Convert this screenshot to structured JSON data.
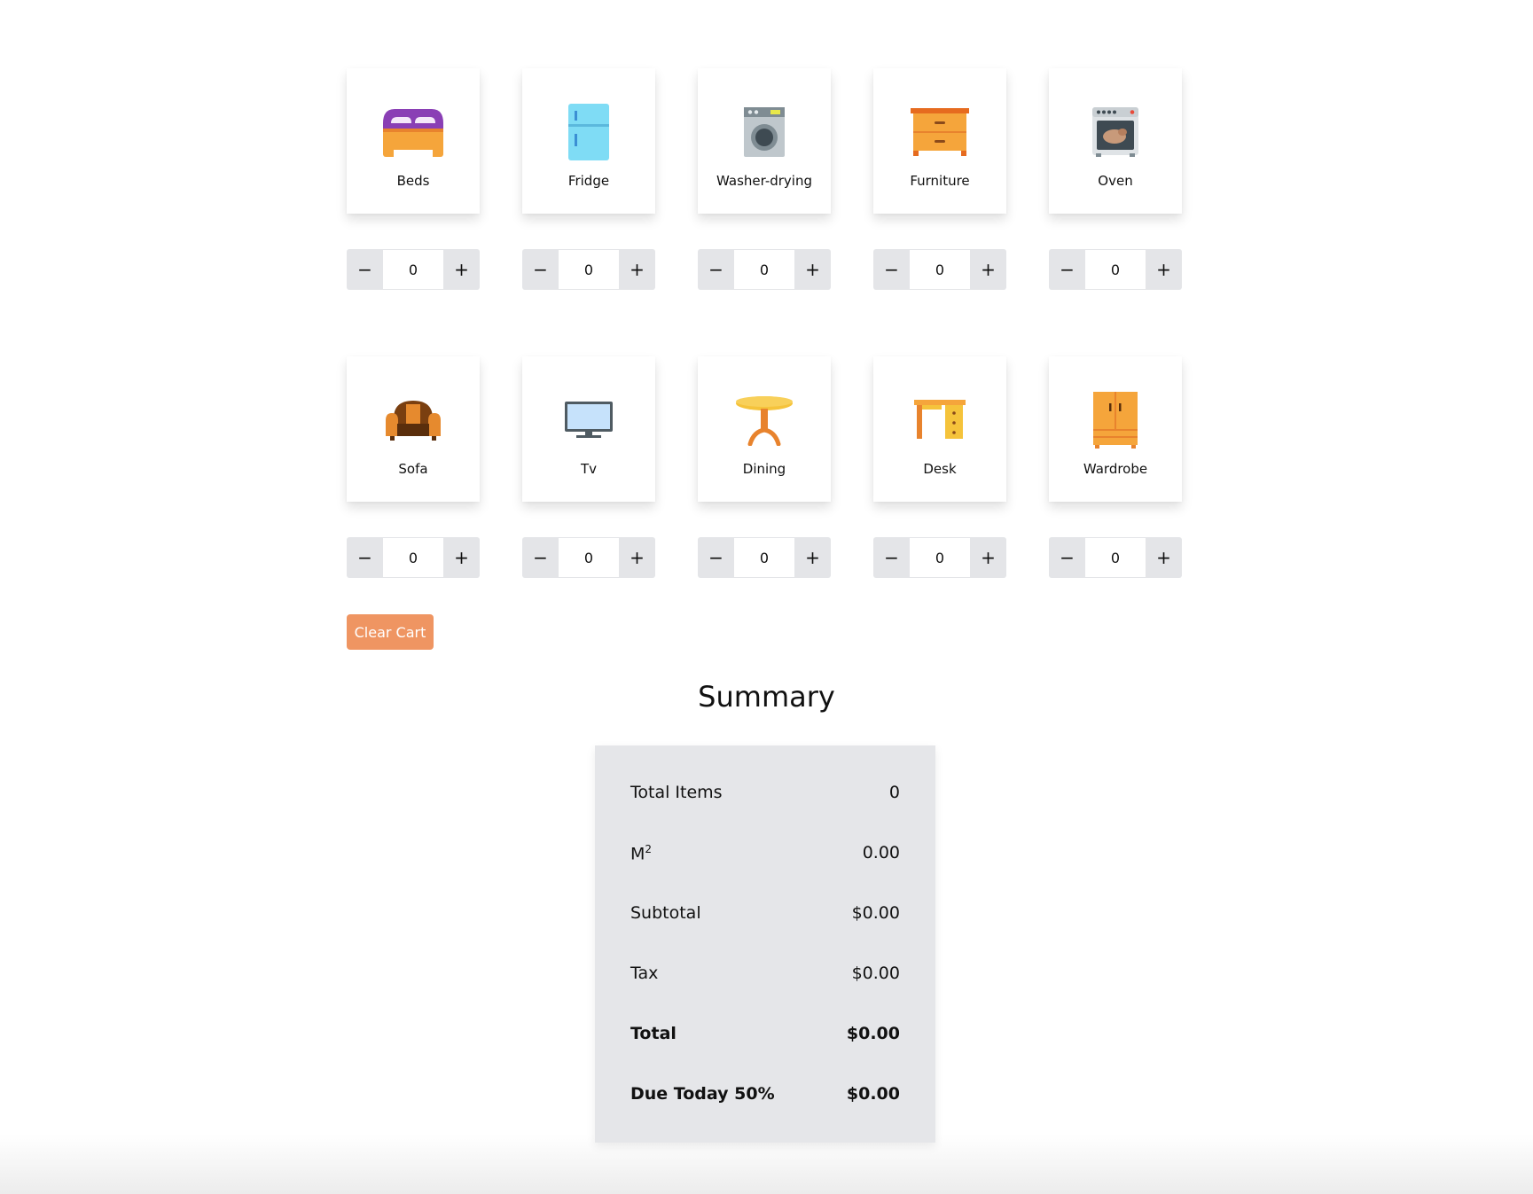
{
  "products": [
    {
      "name": "Beds",
      "icon": "bed-icon",
      "qty": "0"
    },
    {
      "name": "Fridge",
      "icon": "fridge-icon",
      "qty": "0"
    },
    {
      "name": "Washer-drying",
      "icon": "washing-machine-icon",
      "qty": "0"
    },
    {
      "name": "Furniture",
      "icon": "dresser-icon",
      "qty": "0"
    },
    {
      "name": "Oven",
      "icon": "oven-icon",
      "qty": "0"
    },
    {
      "name": "Sofa",
      "icon": "armchair-icon",
      "qty": "0"
    },
    {
      "name": "Tv",
      "icon": "tv-icon",
      "qty": "0"
    },
    {
      "name": "Dining",
      "icon": "dining-table-icon",
      "qty": "0"
    },
    {
      "name": "Desk",
      "icon": "desk-icon",
      "qty": "0"
    },
    {
      "name": "Wardrobe",
      "icon": "wardrobe-icon",
      "qty": "0"
    }
  ],
  "stepper": {
    "minus": "−",
    "plus": "+"
  },
  "clear_cart_label": "Clear Cart",
  "summary": {
    "title": "Summary",
    "total_items_label": "Total Items",
    "total_items_value": "0",
    "area_label": "M",
    "area_sup": "2",
    "area_value": "0.00",
    "subtotal_label": "Subtotal",
    "subtotal_value": "$0.00",
    "tax_label": "Tax",
    "tax_value": "$0.00",
    "total_label": "Total",
    "total_value": "$0.00",
    "due_label": "Due Today 50%",
    "due_value": "$0.00"
  },
  "colors": {
    "accent": "#ef9562",
    "panel_bg": "#e5e6e9",
    "stepper_btn_bg": "#e4e5e8"
  }
}
